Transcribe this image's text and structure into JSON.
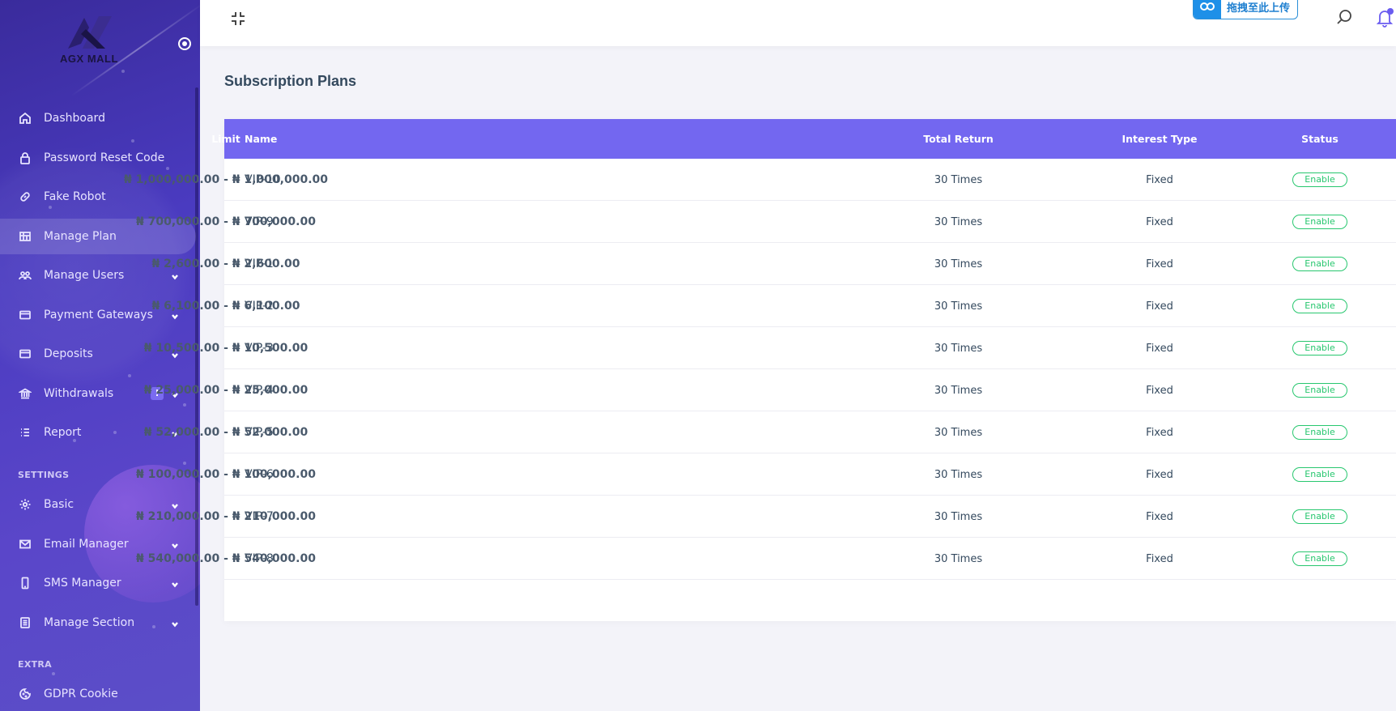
{
  "brand": {
    "name": "AGX MALL"
  },
  "sidebar": {
    "items": [
      {
        "label": "Dashboard",
        "icon": "home-icon",
        "has_children": false
      },
      {
        "label": "Password Reset Code",
        "icon": "lock-icon",
        "has_children": false
      },
      {
        "label": "Fake Robot",
        "icon": "link-icon",
        "has_children": false
      },
      {
        "label": "Manage Plan",
        "icon": "plan-icon",
        "has_children": false,
        "active": true
      },
      {
        "label": "Manage Users",
        "icon": "users-icon",
        "has_children": true
      },
      {
        "label": "Payment Gateways",
        "icon": "credit-card-icon",
        "has_children": true
      },
      {
        "label": "Deposits",
        "icon": "credit-card-icon",
        "has_children": true
      },
      {
        "label": "Withdrawals",
        "icon": "bank-icon",
        "has_children": true,
        "badge": "!"
      },
      {
        "label": "Report",
        "icon": "list-icon",
        "has_children": true
      }
    ],
    "section_settings": "SETTINGS",
    "settings_items": [
      {
        "label": "Basic",
        "icon": "gear-icon",
        "has_children": true
      },
      {
        "label": "Email Manager",
        "icon": "mail-icon",
        "has_children": true
      },
      {
        "label": "SMS Manager",
        "icon": "mobile-icon",
        "has_children": true
      },
      {
        "label": "Manage Section",
        "icon": "page-icon",
        "has_children": true
      }
    ],
    "section_extra": "EXTRA",
    "extra_items": [
      {
        "label": "GDPR Cookie",
        "icon": "cookie-icon",
        "has_children": false
      }
    ]
  },
  "topbar": {
    "upload_label": "拖拽至此上传"
  },
  "page": {
    "title": "Subscription Plans"
  },
  "table": {
    "columns": [
      "Name",
      "Limit",
      "Total Return",
      "Interest Type",
      "Status"
    ],
    "rows": [
      {
        "name": "VIP-10",
        "limit": "₦ 1,000,000.00 - ₦ 1,000,000.00",
        "total_return": "30 Times",
        "interest_type": "Fixed",
        "status": "Enable"
      },
      {
        "name": "VIP-9",
        "limit": "₦ 700,000.00 - ₦ 700,000.00",
        "total_return": "30 Times",
        "interest_type": "Fixed",
        "status": "Enable"
      },
      {
        "name": "VIP-1",
        "limit": "₦ 2,600.00 - ₦ 2,600.00",
        "total_return": "30 Times",
        "interest_type": "Fixed",
        "status": "Enable"
      },
      {
        "name": "VIP-2",
        "limit": "₦ 6,100.00 - ₦ 6,100.00",
        "total_return": "30 Times",
        "interest_type": "Fixed",
        "status": "Enable"
      },
      {
        "name": "VIP-3",
        "limit": "₦ 10,500.00 - ₦ 10,500.00",
        "total_return": "30 Times",
        "interest_type": "Fixed",
        "status": "Enable"
      },
      {
        "name": "VIP-4",
        "limit": "₦ 25,000.00 - ₦ 25,000.00",
        "total_return": "30 Times",
        "interest_type": "Fixed",
        "status": "Enable"
      },
      {
        "name": "VIP-5",
        "limit": "₦ 52,000.00 - ₦ 52,000.00",
        "total_return": "30 Times",
        "interest_type": "Fixed",
        "status": "Enable"
      },
      {
        "name": "VIP-6",
        "limit": "₦ 100,000.00 - ₦ 100,000.00",
        "total_return": "30 Times",
        "interest_type": "Fixed",
        "status": "Enable"
      },
      {
        "name": "VIP-7",
        "limit": "₦ 210,000.00 - ₦ 210,000.00",
        "total_return": "30 Times",
        "interest_type": "Fixed",
        "status": "Enable"
      },
      {
        "name": "VIP-8",
        "limit": "₦ 540,000.00 - ₦ 540,000.00",
        "total_return": "30 Times",
        "interest_type": "Fixed",
        "status": "Enable"
      }
    ]
  },
  "colors": {
    "accent": "#7367f0",
    "status_enable": "#28c76f",
    "sidebar_bg": "#4a3bc0"
  }
}
